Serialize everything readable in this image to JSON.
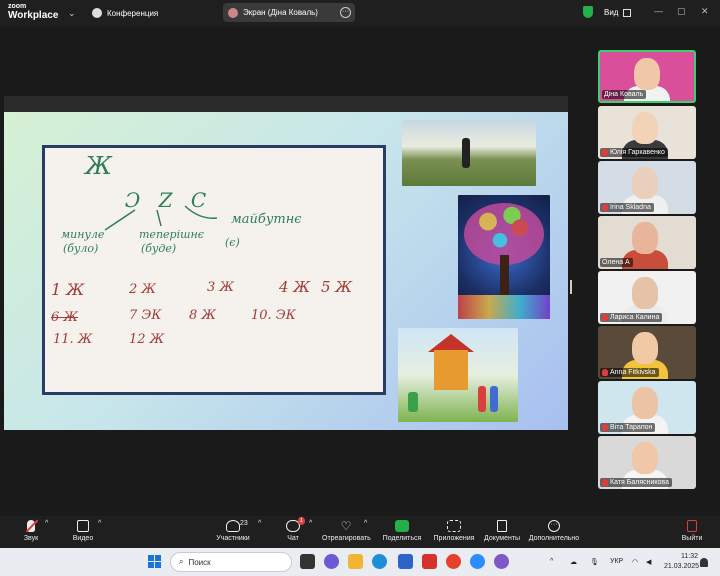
{
  "app": {
    "logo_line1": "zoom",
    "logo_line2": "Workplace",
    "conference_label": "Конференция",
    "screen_share_label": "Экран (Діна Коваль)",
    "view_label": "Вид",
    "accent_color": "#23b04a"
  },
  "slide": {
    "letter_title": "Ж",
    "center_letters": "Ɔ Z C",
    "past_label": "минуле",
    "past_sub": "(було)",
    "present_label": "теперішнє",
    "present_sub": "(буде)",
    "future_label": "майбутнє",
    "future_sub": "(є)",
    "row1": [
      "1 Ж",
      "2 Ж",
      "3 Ж",
      "4 Ж",
      "5 Ж"
    ],
    "row2": [
      "6 Ж",
      "7 ЭК",
      "8 Ж",
      "10. ЭК"
    ],
    "row3": [
      "11. Ж",
      "12 Ж"
    ],
    "images": [
      "person-on-hill",
      "colorful-tree",
      "children-drawing-house"
    ]
  },
  "participants": [
    {
      "name": "Діна Коваль",
      "muted": false,
      "active": true,
      "bg": "#d94f9a",
      "skin": "#f0c7a8",
      "shirt": "#f2f2f2"
    },
    {
      "name": "Юлія Гаркавенко",
      "muted": true,
      "active": false,
      "bg": "#e9e2d9",
      "skin": "#f3d3b8",
      "shirt": "#3b3b3b"
    },
    {
      "name": "Irina Skladna",
      "muted": true,
      "active": false,
      "bg": "#d4dde6",
      "skin": "#ead0bc",
      "shirt": "#f0f0f0"
    },
    {
      "name": "Олена А",
      "muted": false,
      "active": false,
      "bg": "#e3dcd3",
      "skin": "#e8b59a",
      "shirt": "#c94d3b"
    },
    {
      "name": "Лариса Калина",
      "muted": true,
      "active": false,
      "bg": "#f1f1f1",
      "skin": "#e6c3a6",
      "shirt": "#ececec"
    },
    {
      "name": "Anna Fitkivska",
      "muted": true,
      "active": false,
      "bg": "#5a4a3a",
      "skin": "#f1c9a5",
      "shirt": "#f2c43d"
    },
    {
      "name": "Віта Тарапон",
      "muted": true,
      "active": false,
      "bg": "#cfe6ef",
      "skin": "#ecc3a5",
      "shirt": "#f3f3f3"
    },
    {
      "name": "Катя Балясникова",
      "muted": true,
      "active": false,
      "bg": "#d9d9d9",
      "skin": "#f0c8a8",
      "shirt": "#f6f6f6"
    }
  ],
  "toolbar": {
    "audio": "Звук",
    "video": "Видео",
    "participants": "Участники",
    "participants_count": "23",
    "chat": "Чат",
    "chat_badge": "1",
    "react": "Отреагировать",
    "share": "Поделиться",
    "apps": "Приложения",
    "docs": "Документы",
    "more": "Дополнительно",
    "leave": "Выйти"
  },
  "taskbar": {
    "search_placeholder": "Поиск",
    "lang": "УКР",
    "time": "11:32",
    "date": "21.03.2025"
  }
}
